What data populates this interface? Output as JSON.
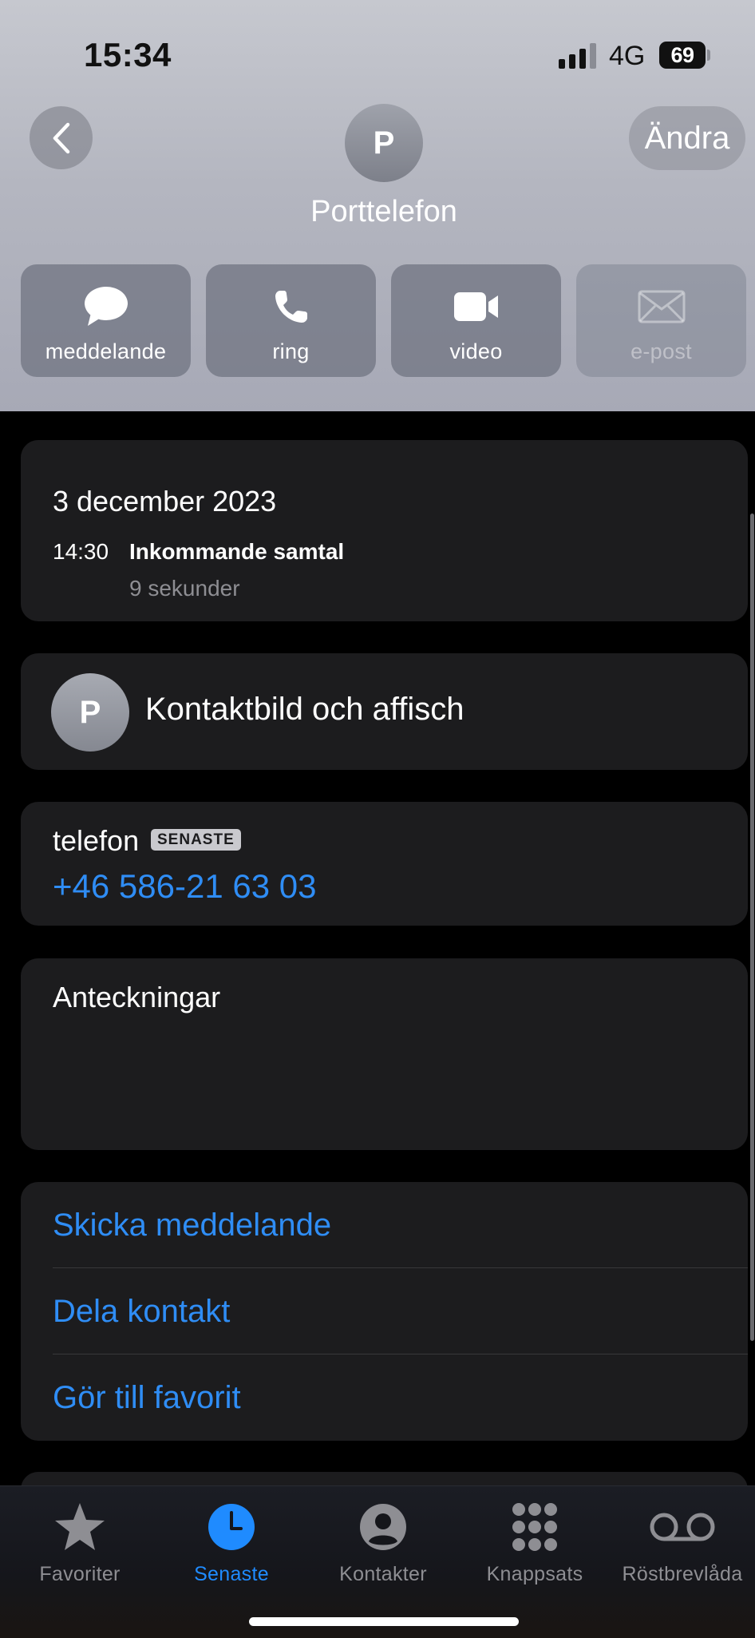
{
  "status_bar": {
    "time": "15:34",
    "network": "4G",
    "battery": "69"
  },
  "header": {
    "back_label": "<",
    "edit_label": "Ändra",
    "avatar_initial": "P",
    "contact_name": "Porttelefon",
    "actions": [
      {
        "label": "meddelande",
        "icon": "message-bubble-icon",
        "enabled": true
      },
      {
        "label": "ring",
        "icon": "phone-icon",
        "enabled": true
      },
      {
        "label": "video",
        "icon": "video-camera-icon",
        "enabled": true
      },
      {
        "label": "e-post",
        "icon": "envelope-icon",
        "enabled": false
      }
    ]
  },
  "recent_call": {
    "date": "3 december 2023",
    "time": "14:30",
    "type": "Inkommande samtal",
    "duration": "9 sekunder"
  },
  "contact_photo": {
    "initial": "P",
    "label": "Kontaktbild och affisch"
  },
  "phone": {
    "label": "telefon",
    "badge": "SENASTE",
    "number": "+46 586-21 63 03"
  },
  "notes": {
    "label": "Anteckningar"
  },
  "links": [
    "Skicka meddelande",
    "Dela kontakt",
    "Gör till favorit"
  ],
  "tabbar": {
    "tabs": [
      {
        "label": "Favoriter",
        "icon": "star-icon",
        "active": false
      },
      {
        "label": "Senaste",
        "icon": "clock-icon",
        "active": true
      },
      {
        "label": "Kontakter",
        "icon": "person-circle-icon",
        "active": false
      },
      {
        "label": "Knappsats",
        "icon": "keypad-icon",
        "active": false
      },
      {
        "label": "Röstbrevlåda",
        "icon": "voicemail-icon",
        "active": false
      }
    ]
  },
  "colors": {
    "accent": "#2f8df5",
    "active_tab": "#1f8bff",
    "card": "#1c1c1e",
    "secondary_text": "#8e8e93"
  }
}
